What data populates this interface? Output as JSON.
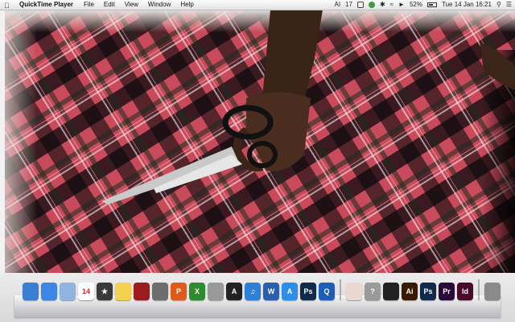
{
  "menubar": {
    "app_name": "QuickTime Player",
    "menus": [
      "File",
      "Edit",
      "View",
      "Window",
      "Help"
    ],
    "status": {
      "ai_badge": "AI",
      "count": "17",
      "battery": "52%",
      "datetime": "Tue 14 Jan  16:21"
    }
  },
  "dock": {
    "calendar_day": "14",
    "items": [
      {
        "name": "finder-icon",
        "label": "",
        "color": "#3b7fd3"
      },
      {
        "name": "safari-icon",
        "label": "",
        "color": "#3d86e6"
      },
      {
        "name": "mail-icon",
        "label": "",
        "color": "#8fb4de"
      },
      {
        "name": "calendar-icon",
        "label": "14",
        "color": "#ffffff"
      },
      {
        "name": "imovie-icon",
        "label": "★",
        "color": "#3a3a3a"
      },
      {
        "name": "stickies-icon",
        "label": "",
        "color": "#f2d14d"
      },
      {
        "name": "photo-booth-icon",
        "label": "",
        "color": "#9a1c1c"
      },
      {
        "name": "preview-icon",
        "label": "",
        "color": "#6d6d6d"
      },
      {
        "name": "powerpoint-icon",
        "label": "P",
        "color": "#e05a1a"
      },
      {
        "name": "excel-icon",
        "label": "X",
        "color": "#2f8b2f"
      },
      {
        "name": "calculator-icon",
        "label": "",
        "color": "#9a9a9a"
      },
      {
        "name": "aperture-icon",
        "label": "A",
        "color": "#222222"
      },
      {
        "name": "itunes-icon",
        "label": "♫",
        "color": "#2f7ed8"
      },
      {
        "name": "word-icon",
        "label": "W",
        "color": "#2a5fb0"
      },
      {
        "name": "app-store-icon",
        "label": "A",
        "color": "#2d8fe8"
      },
      {
        "name": "photoshop-icon",
        "label": "Ps",
        "color": "#0f2a4a"
      },
      {
        "name": "quicktime-icon",
        "label": "Q",
        "color": "#1d5fb8"
      },
      {
        "name": "photo-doc-icon",
        "label": "",
        "color": "#e8d8d0"
      },
      {
        "name": "help-icon",
        "label": "?",
        "color": "#9a9a9a"
      },
      {
        "name": "film-icon",
        "label": "",
        "color": "#222222"
      },
      {
        "name": "illustrator-icon",
        "label": "Ai",
        "color": "#3b1a02"
      },
      {
        "name": "photoshop-icon-2",
        "label": "Ps",
        "color": "#0f2a4a"
      },
      {
        "name": "premiere-icon",
        "label": "Pr",
        "color": "#2a0a3a"
      },
      {
        "name": "indesign-icon",
        "label": "Id",
        "color": "#4a0a28"
      },
      {
        "name": "trash-icon",
        "label": "",
        "color": "#8a8a8a"
      }
    ]
  }
}
